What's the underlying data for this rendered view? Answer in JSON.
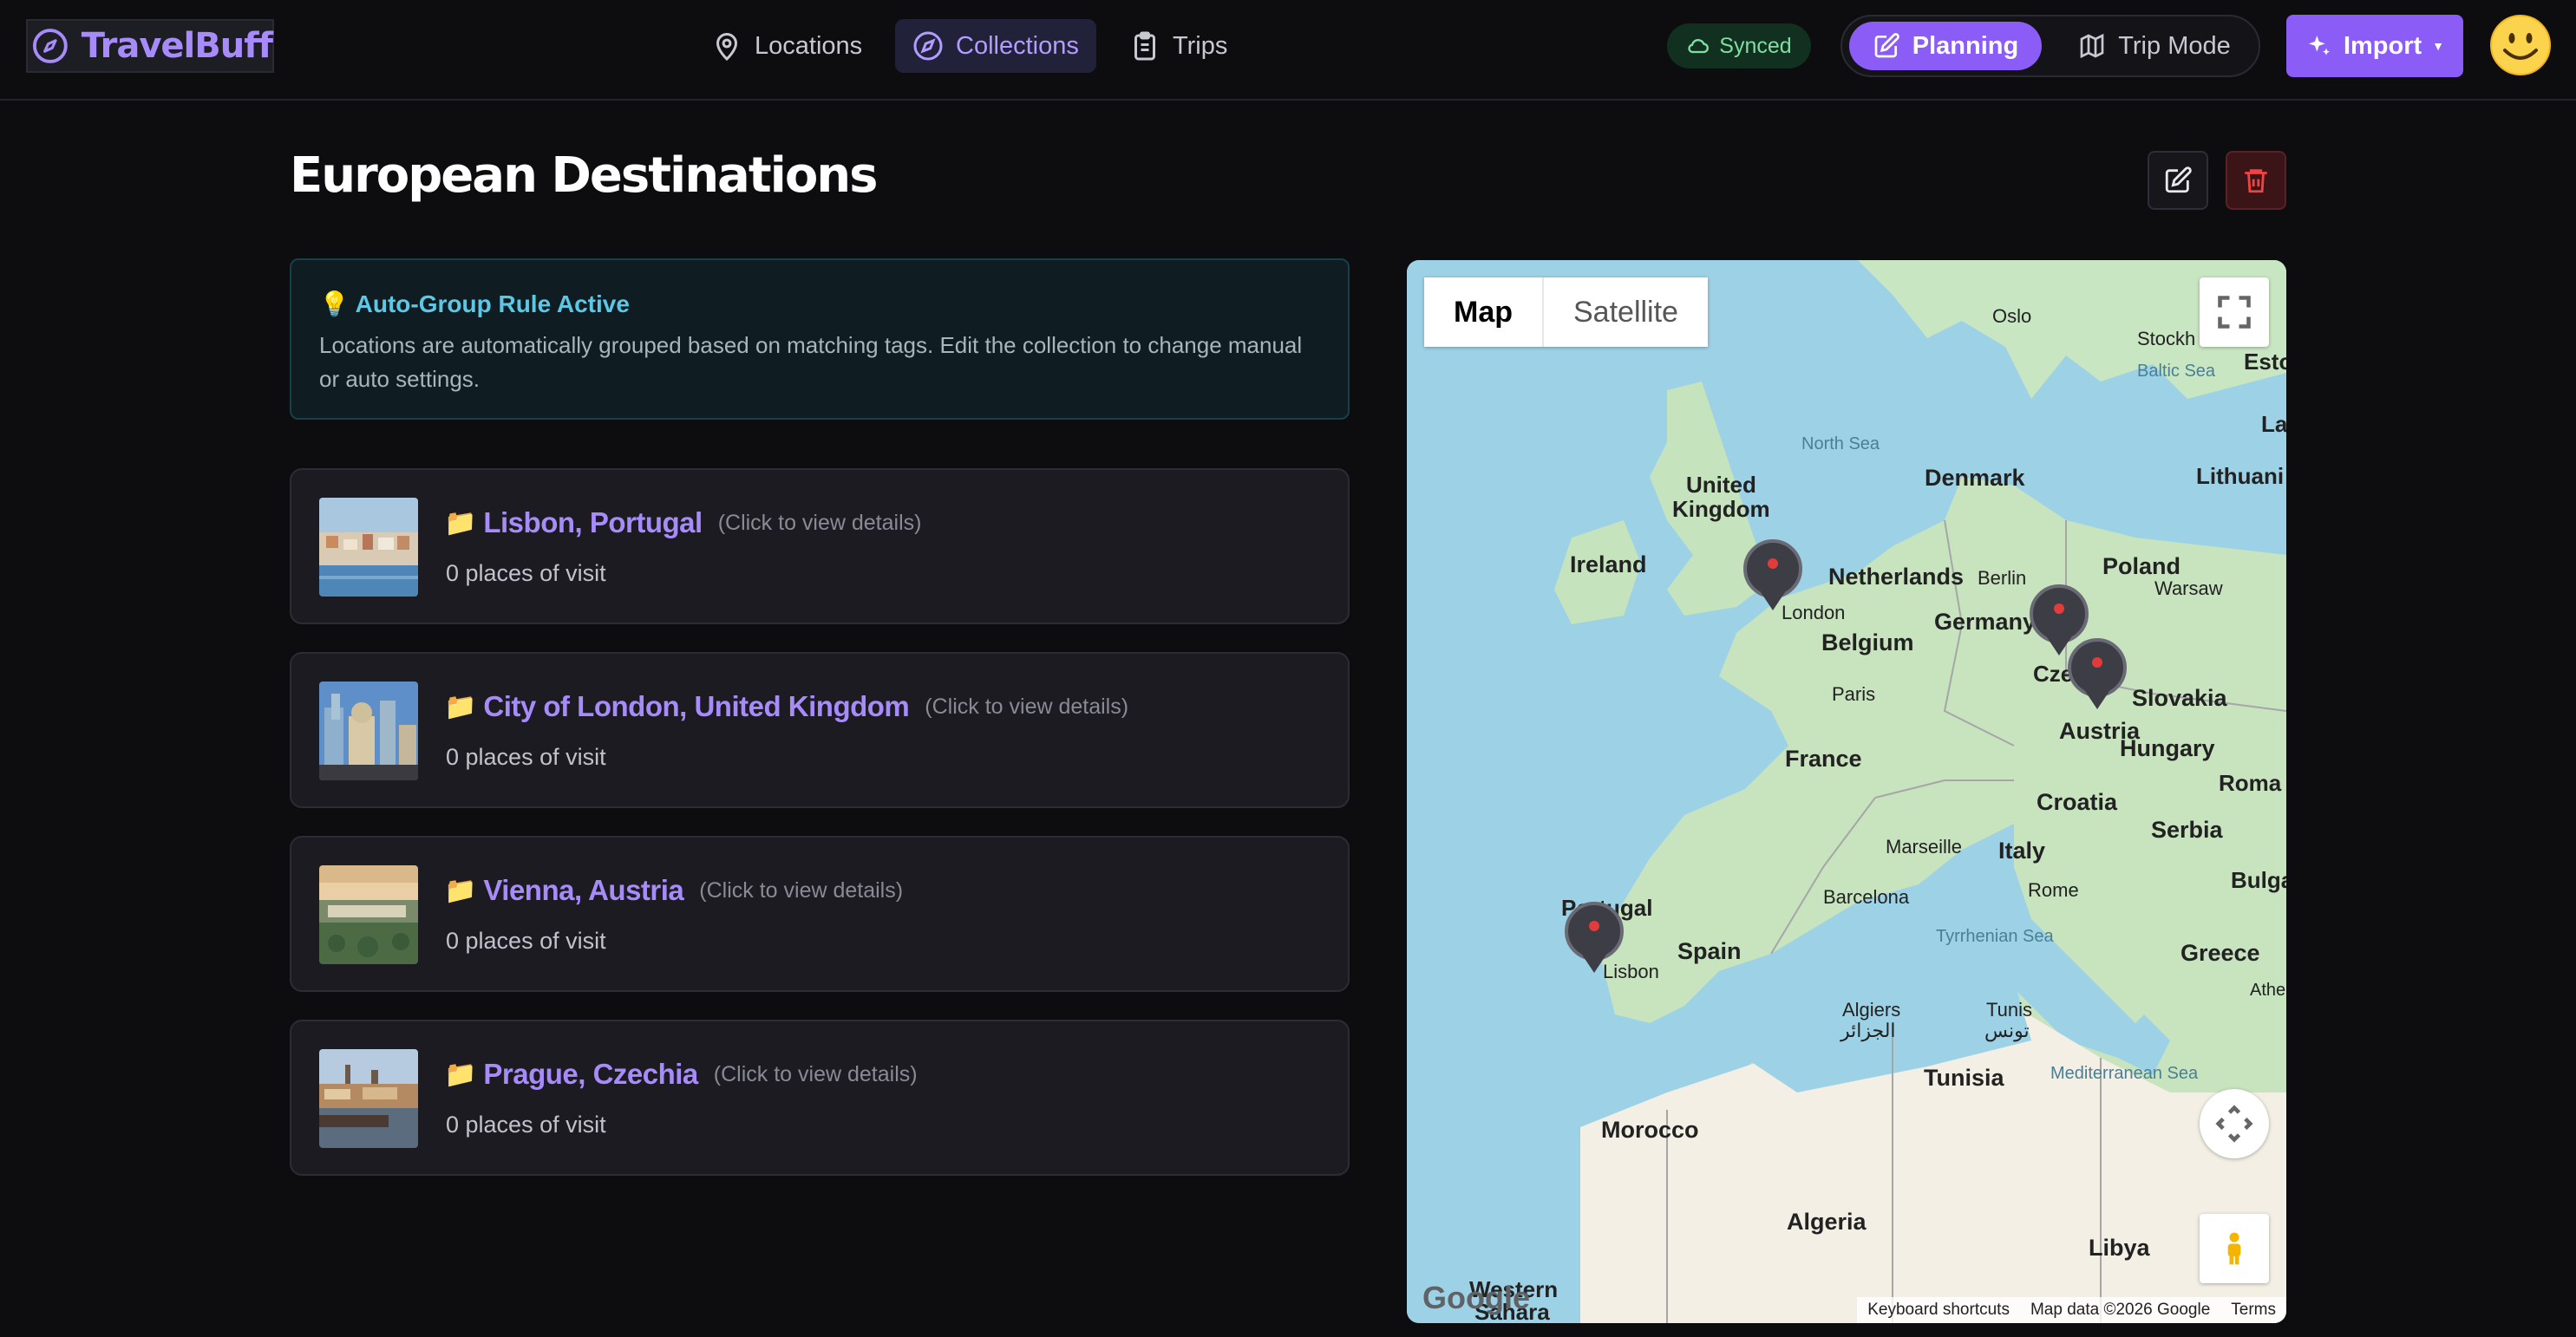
{
  "app": {
    "name": "TravelBuff"
  },
  "nav": {
    "tabs": [
      {
        "label": "Locations",
        "icon": "map-pin-icon",
        "active": false
      },
      {
        "label": "Collections",
        "icon": "compass-icon",
        "active": true
      },
      {
        "label": "Trips",
        "icon": "clipboard-icon",
        "active": false
      }
    ],
    "sync_status": "Synced",
    "mode": {
      "planning": "Planning",
      "trip": "Trip Mode",
      "active": "planning"
    },
    "import_label": "Import",
    "avatar": "smiley-avatar"
  },
  "collection": {
    "title": "European Destinations",
    "rule": {
      "title": "Auto-Group Rule Active",
      "text": "Locations are automatically grouped based on matching tags. Edit the collection to change manual or auto settings."
    },
    "hint": "(Click to view details)",
    "items": [
      {
        "name": "Lisbon, Portugal",
        "sub": "0 places of visit"
      },
      {
        "name": "City of London, United Kingdom",
        "sub": "0 places of visit"
      },
      {
        "name": "Vienna, Austria",
        "sub": "0 places of visit"
      },
      {
        "name": "Prague, Czechia",
        "sub": "0 places of visit"
      }
    ]
  },
  "map": {
    "type_options": [
      "Map",
      "Satellite"
    ],
    "selected_type": "Map",
    "labels": {
      "oslo": "Oslo",
      "stockholm": "Stockh",
      "esto": "Esto",
      "baltic": "Baltic Sea",
      "lat": "Lat",
      "north_sea": "North Sea",
      "denmark": "Denmark",
      "lithuania": "Lithuani",
      "uk": "United",
      "uk2": "Kingdom",
      "ireland": "Ireland",
      "netherlands": "Netherlands",
      "berlin": "Berlin",
      "poland": "Poland",
      "warsaw": "Warsaw",
      "london": "London",
      "germany": "Germany",
      "belgium": "Belgium",
      "czechia": "Cze",
      "paris": "Paris",
      "slovakia": "Slovakia",
      "austria": "Austria",
      "hungary": "Hungary",
      "france": "France",
      "romania": "Roma",
      "croatia": "Croatia",
      "serbia": "Serbia",
      "marseille": "Marseille",
      "italy": "Italy",
      "rome": "Rome",
      "bulgaria": "Bulga",
      "portugal": "Portugal",
      "barcelona": "Barcelona",
      "tyrrhenian": "Tyrrhenian Sea",
      "spain": "Spain",
      "greece": "Greece",
      "lisbon": "Lisbon",
      "athens": "Athe",
      "algiers": "Algiers",
      "algiers_ar": "الجزائر",
      "tunis": "Tunis",
      "tunis_ar": "تونس",
      "tunisia": "Tunisia",
      "mediterranean": "Mediterranean Sea",
      "morocco": "Morocco",
      "algeria": "Algeria",
      "libya": "Libya",
      "western": "Western",
      "sahara": "Sahara"
    },
    "google": "Google",
    "footer": [
      "Keyboard shortcuts",
      "Map data ©2026 Google",
      "Terms"
    ]
  }
}
